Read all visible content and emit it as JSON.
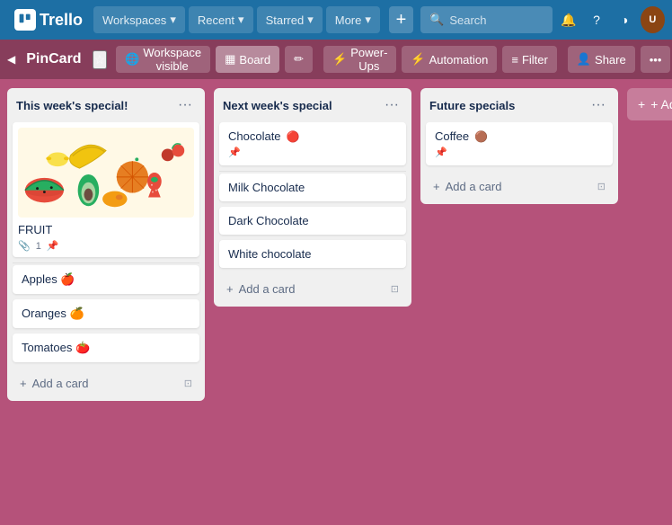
{
  "topNav": {
    "logo": "Trello",
    "workspaces": "Workspaces",
    "recent": "Recent",
    "starred": "Starred",
    "more": "More",
    "search_placeholder": "Search",
    "add_tooltip": "Create"
  },
  "boardHeader": {
    "title": "PinCard",
    "workspace_visible": "Workspace visible",
    "board": "Board",
    "power_ups": "Power-Ups",
    "automation": "Automation",
    "filter": "Filter",
    "share": "Share"
  },
  "lists": [
    {
      "id": "list1",
      "title": "This week's special!",
      "cards": [
        {
          "id": "c1",
          "type": "image",
          "title": "FRUIT",
          "attachments": 1,
          "pinned": true
        },
        {
          "id": "c2",
          "type": "text",
          "title": "Apples 🍎"
        },
        {
          "id": "c3",
          "type": "text",
          "title": "Oranges 🍊"
        },
        {
          "id": "c4",
          "type": "text",
          "title": "Tomatoes 🍅"
        }
      ],
      "add_card": "+ Add a card"
    },
    {
      "id": "list2",
      "title": "Next week's special",
      "cards": [
        {
          "id": "c5",
          "type": "label",
          "title": "Chocolate",
          "label_color": "#eb5a46",
          "label_symbol": "🔴",
          "pinned": true
        },
        {
          "id": "c6",
          "type": "text",
          "title": "Milk Chocolate"
        },
        {
          "id": "c7",
          "type": "text",
          "title": "Dark Chocolate"
        },
        {
          "id": "c8",
          "type": "text",
          "title": "White chocolate"
        }
      ],
      "add_card": "+ Add a card"
    },
    {
      "id": "list3",
      "title": "Future specials",
      "cards": [
        {
          "id": "c9",
          "type": "label",
          "title": "Coffee",
          "label_color": "#7b3f00",
          "label_symbol": "🟤",
          "pinned": true
        }
      ],
      "add_card": "+ Add a card"
    }
  ],
  "addAnotherList": "+ Add another"
}
